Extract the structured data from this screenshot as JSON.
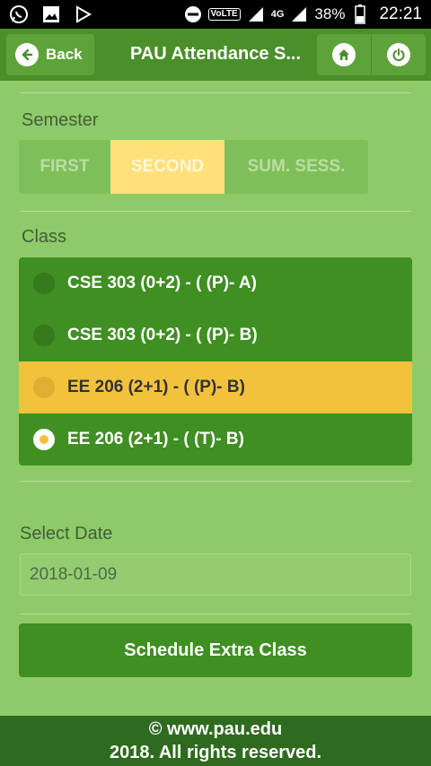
{
  "status_bar": {
    "icons_left": [
      "whatsapp-icon",
      "gallery-icon",
      "play-store-icon"
    ],
    "volte": "VoLTE",
    "network": "4G",
    "battery": "38%",
    "time": "22:21"
  },
  "header": {
    "back_label": "Back",
    "title": "PAU Attendance S..."
  },
  "semester": {
    "label": "Semester",
    "options": [
      "FIRST",
      "SECOND",
      "SUM. SESS."
    ],
    "selected": "SECOND"
  },
  "class_section": {
    "label": "Class",
    "items": [
      {
        "label": "CSE 303 (0+2) - ( (P)- A)",
        "checked": false,
        "highlight": false
      },
      {
        "label": "CSE 303 (0+2) - ( (P)- B)",
        "checked": false,
        "highlight": false
      },
      {
        "label": "EE 206 (2+1) - ( (P)- B)",
        "checked": false,
        "highlight": true
      },
      {
        "label": "EE 206 (2+1) - ( (T)- B)",
        "checked": true,
        "highlight": false
      }
    ]
  },
  "date": {
    "label": "Select Date",
    "value": "2018-01-09"
  },
  "action": {
    "label": "Schedule Extra Class"
  },
  "footer": {
    "line1": "© www.pau.edu",
    "line2": "2018. All rights reserved."
  },
  "colors": {
    "background": "#8fca6a",
    "primary": "#3f8f22",
    "header": "#4a8f2a",
    "accent": "#f3c23d",
    "footer": "#2e6b1e"
  }
}
